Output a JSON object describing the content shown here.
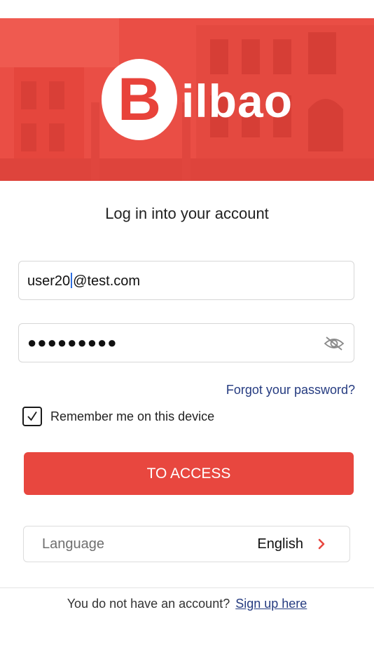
{
  "header": {
    "logo_letter": "B",
    "logo_rest": "ilbao",
    "brand_color": "#ea4e45"
  },
  "login": {
    "title": "Log in into your account",
    "email_value_before_caret": "user20",
    "email_value_after_caret": "@test.com",
    "password_masked": "●●●●●●●●●",
    "password_toggle_icon": "eye-slash-icon",
    "forgot_password": "Forgot your password?",
    "remember_label": "Remember me on this device",
    "remember_checked": true,
    "submit_label": "TO ACCESS"
  },
  "language": {
    "label": "Language",
    "value": "English",
    "chevron_icon": "chevron-right-icon"
  },
  "footer": {
    "prompt": "You do not have an account?",
    "signup_link": "Sign up here"
  },
  "colors": {
    "accent": "#e8473f",
    "link": "#253b80",
    "caret": "#2f6fe0"
  }
}
